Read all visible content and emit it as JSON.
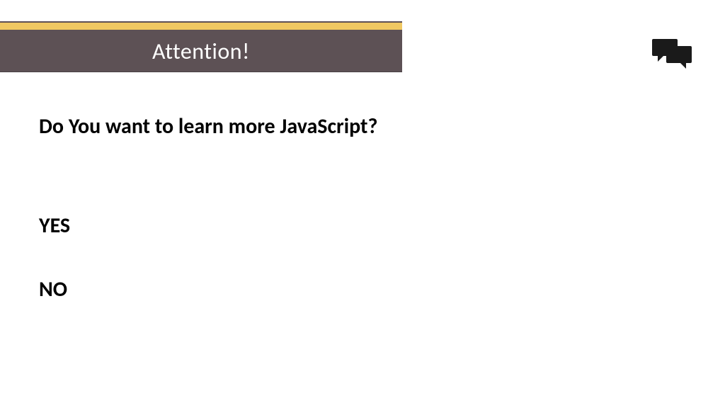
{
  "header": {
    "title": "Attention!"
  },
  "content": {
    "question": "Do You want to learn more JavaScript?",
    "option_yes": "YES",
    "option_no": "NO"
  }
}
